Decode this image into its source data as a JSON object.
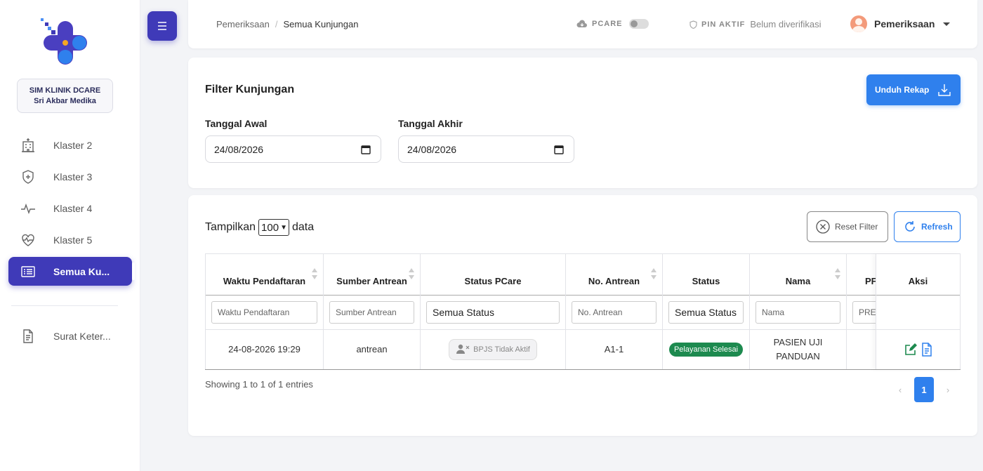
{
  "sidebar": {
    "clinic_name": "SIM KLINIK DCARE",
    "clinic_branch": "Sri Akbar Medika",
    "items": [
      {
        "label": "Klaster 2",
        "icon": "hospital-icon"
      },
      {
        "label": "Klaster 3",
        "icon": "shield-plus-icon"
      },
      {
        "label": "Klaster 4",
        "icon": "pulse-icon"
      },
      {
        "label": "Klaster 5",
        "icon": "heart-pulse-icon"
      },
      {
        "label": "Semua Ku...",
        "icon": "list-icon",
        "active": true
      }
    ],
    "items2": [
      {
        "label": "Surat Keter...",
        "icon": "document-icon"
      }
    ]
  },
  "topbar": {
    "breadcrumb": [
      "Pemeriksaan",
      "Semua Kunjungan"
    ],
    "pcare_label": "PCARE",
    "pin_label": "PIN AKTIF",
    "pin_value": "Belum diverifikasi",
    "user_name": "Pemeriksaan"
  },
  "filter": {
    "title": "Filter Kunjungan",
    "download_label": "Unduh Rekap",
    "start_label": "Tanggal Awal",
    "start_value": "24/08/2026",
    "end_label": "Tanggal Akhir",
    "end_value": "24/08/2026"
  },
  "table": {
    "show_prefix": "Tampilkan",
    "show_value": "100",
    "show_suffix": "data",
    "reset_label": "Reset Filter",
    "refresh_label": "Refresh",
    "columns": [
      {
        "header": "Waktu Pendaftaran",
        "filter": "Waktu Pendaftaran",
        "sortable": true
      },
      {
        "header": "Sumber Antrean",
        "filter": "Sumber Antrean",
        "sortable": true
      },
      {
        "header": "Status PCare",
        "filter": "Semua Status",
        "sortable": false
      },
      {
        "header": "No. Antrean",
        "filter": "No. Antrean",
        "sortable": true
      },
      {
        "header": "Status",
        "filter": "Semua Status",
        "sortable": false
      },
      {
        "header": "Nama",
        "filter": "Nama",
        "sortable": true
      },
      {
        "header": "PF",
        "filter": "PRE",
        "sortable": false
      },
      {
        "header": "Aksi",
        "filter": "",
        "sortable": false
      }
    ],
    "row": {
      "waktu": "24-08-2026 19:29",
      "sumber": "antrean",
      "pcare_status": "BPJS Tidak Aktif",
      "no_antrean": "A1-1",
      "status": "Pelayanan Selesai",
      "nama": "PASIEN UJI PANDUAN"
    },
    "showing": "Showing 1 to 1 of 1 entries",
    "page": "1",
    "prev": "‹",
    "next": "›"
  },
  "colors": {
    "primary": "#3f3ab8",
    "accent": "#2f80ed",
    "success": "#1d8a4f"
  }
}
